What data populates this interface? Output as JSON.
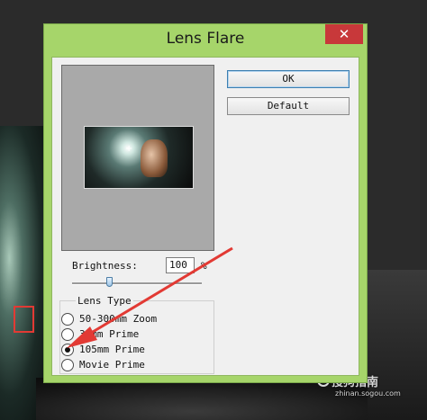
{
  "dialog": {
    "title": "Lens Flare",
    "close_label": "✕",
    "ok_label": "OK",
    "default_label": "Default",
    "brightness": {
      "label": "Brightness:",
      "value": "100",
      "unit": "%",
      "slider_fraction": 0.42
    },
    "lens_type": {
      "label": "Lens Type",
      "options": [
        {
          "label": "50-300mm Zoom",
          "selected": false
        },
        {
          "label": "35mm Prime",
          "selected": false
        },
        {
          "label": "105mm Prime",
          "selected": true
        },
        {
          "label": "Movie Prime",
          "selected": false
        }
      ]
    }
  },
  "watermark": {
    "text": "搜狗指南",
    "url": "zhinan.sogou.com"
  },
  "annotation_color": "#e23a34"
}
